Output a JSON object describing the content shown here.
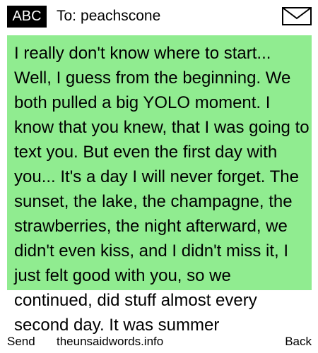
{
  "header": {
    "input_mode": "ABC",
    "to_label": "To:",
    "recipient": "peachscone",
    "mail_icon": "envelope-icon"
  },
  "message": {
    "body": "I really don't know where to start... Well, I guess from the beginning. We both pulled a big YOLO moment. I know that you knew, that I was going to text you. But even the first day with you... It's a day I will never forget. The sunset, the lake, the champagne, the strawberries, the night afterward, we didn't even kiss, and I didn't miss it, I just felt good with you, so we continued, did stuff almost every second day. It was summer",
    "highlight_color": "#90ec90"
  },
  "softkeys": {
    "left": "Send",
    "center": "theunsaidwords.info",
    "right": "Back"
  }
}
